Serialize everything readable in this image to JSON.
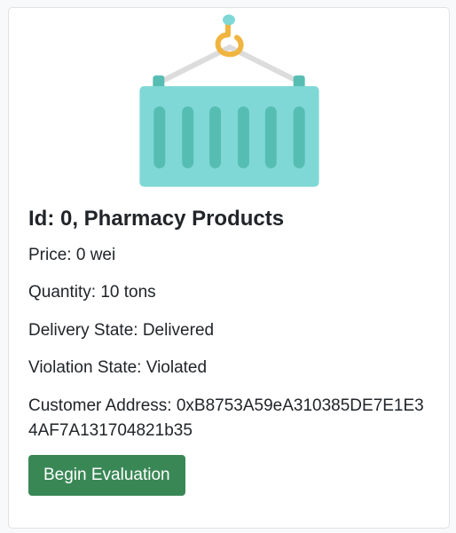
{
  "card": {
    "image_icon": "shipping-container-icon",
    "title": "Id: 0, Pharmacy Products",
    "price": "Price: 0 wei",
    "quantity": "Quantity: 10 tons",
    "delivery_state": "Delivery State: Delivered",
    "violation_state": "Violation State: Violated",
    "customer_address": "Customer Address: 0xB8753A59eA310385DE7E1E34AF7A131704821b35",
    "button_label": "Begin Evaluation"
  },
  "colors": {
    "container": "#7fd8d6",
    "container_ribs": "#56bdb3",
    "hook": "#f0b540",
    "rope": "#dcdcdc",
    "button": "#3a8756"
  }
}
